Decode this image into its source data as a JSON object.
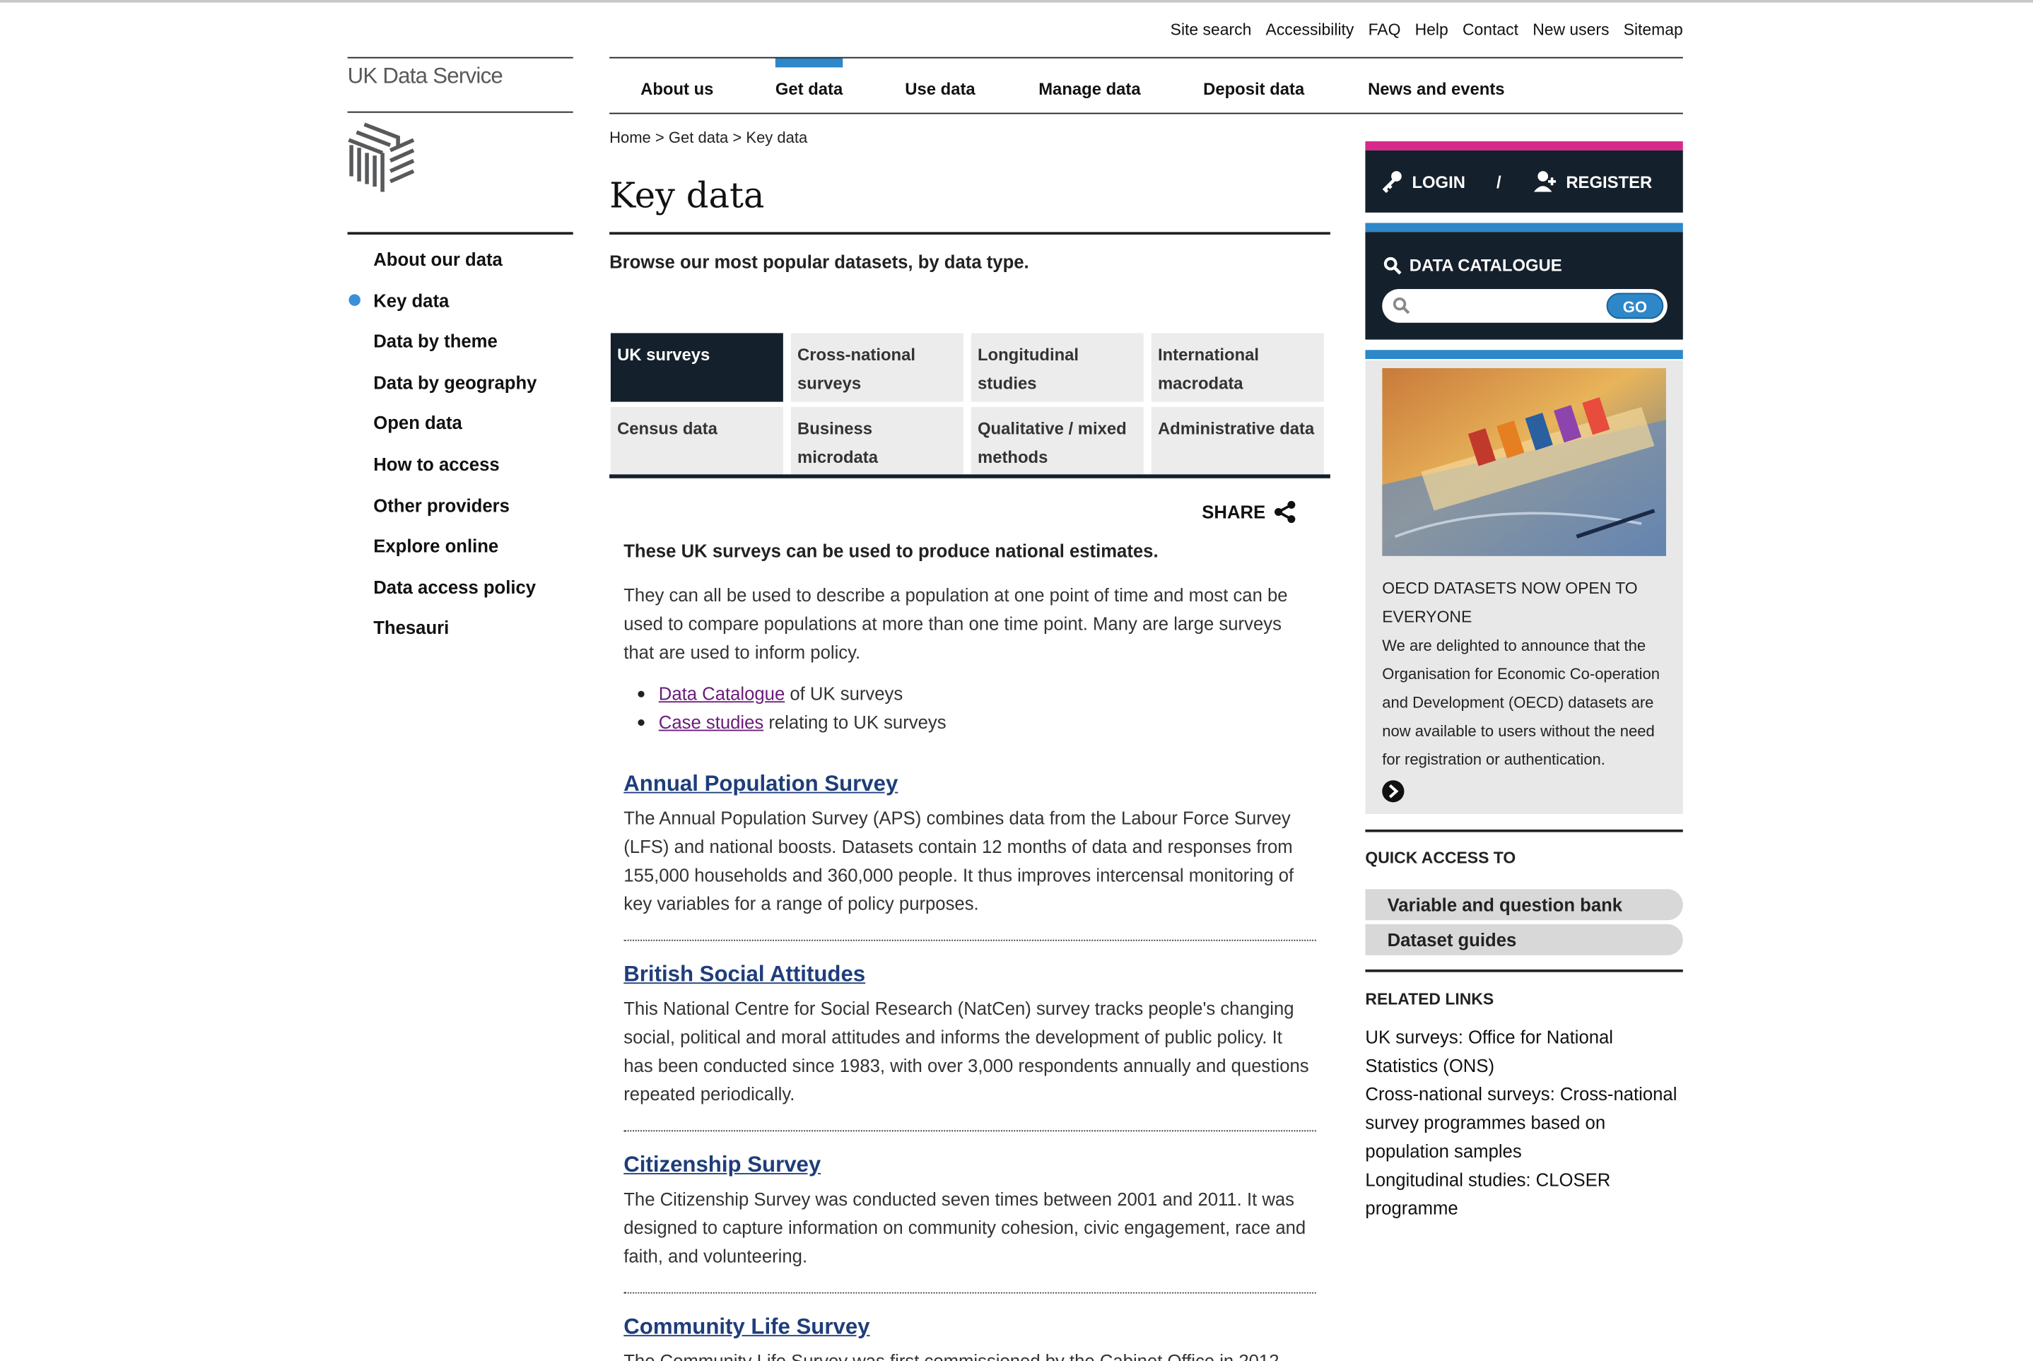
{
  "utility_links": [
    "Site search",
    "Accessibility",
    "FAQ",
    "Help",
    "Contact",
    "New users",
    "Sitemap"
  ],
  "logo": {
    "text": "UK Data Service"
  },
  "main_nav": [
    "About us",
    "Get data",
    "Use data",
    "Manage data",
    "Deposit data",
    "News and events"
  ],
  "main_nav_active": "Get data",
  "side_nav": [
    "About our data",
    "Key data",
    "Data by theme",
    "Data by geography",
    "Open data",
    "How to access",
    "Other providers",
    "Explore online",
    "Data access policy",
    "Thesauri"
  ],
  "side_nav_active": "Key data",
  "breadcrumb": "Home > Get data > Key data",
  "page": {
    "title": "Key data",
    "intro": "Browse our most popular datasets, by data type.",
    "share_label": "SHARE"
  },
  "tabs": {
    "row1": [
      "UK surveys",
      "Cross-national surveys",
      "Longitudinal studies",
      "International macrodata"
    ],
    "row2": [
      "Census data",
      "Business microdata",
      "Qualitative / mixed methods",
      "Administrative data"
    ],
    "active": "UK surveys"
  },
  "content": {
    "lead": "These UK surveys can be used to produce national estimates.",
    "paragraph": "They can all be used to describe a population at one point of time and most can be used to compare populations at more than one time point. Many are large surveys that are used to inform policy.",
    "links": [
      {
        "link": "Data Catalogue",
        "rest": " of UK surveys"
      },
      {
        "link": "Case studies",
        "rest": " relating to UK surveys"
      }
    ],
    "surveys": [
      {
        "title": "Annual Population Survey",
        "desc": "The Annual Population Survey (APS) combines data from the Labour Force Survey (LFS) and national boosts. Datasets contain 12 months of data and responses from 155,000 households and 360,000 people. It thus improves intercensal monitoring of key variables for a range of policy purposes."
      },
      {
        "title": "British Social Attitudes",
        "desc": "This National Centre for Social Research (NatCen) survey tracks people's changing social, political and moral attitudes and informs the development of public policy. It has been conducted since 1983, with over 3,000 respondents annually and questions repeated periodically."
      },
      {
        "title": "Citizenship Survey",
        "desc": "The Citizenship Survey was conducted seven times between 2001 and 2011. It was designed to capture information on community cohesion, civic engagement, race and faith, and volunteering."
      },
      {
        "title": "Community Life Survey",
        "desc": "The Community Life Survey was first commissioned by the Cabinet Office in 2012"
      }
    ]
  },
  "sidebar": {
    "login": "LOGIN",
    "separator": "/",
    "register": "REGISTER",
    "catalogue_title": "DATA CATALOGUE",
    "search_placeholder": "",
    "go_label": "GO",
    "news_title": "OECD DATASETS NOW OPEN TO EVERYONE",
    "news_body": "We are delighted to announce that the Organisation for Economic Co-operation and Development (OECD) datasets are now available to users without the need for registration or authentication.",
    "quick_access_title": "QUICK ACCESS TO",
    "quick_access": [
      "Variable and question bank",
      "Dataset guides"
    ],
    "related_title": "RELATED LINKS",
    "related": [
      "UK surveys: Office for National Statistics (ONS)",
      "Cross-national surveys: Cross-national survey programmes based on population samples",
      "Longitudinal studies: CLOSER programme"
    ]
  },
  "colors": {
    "accent_blue": "#2e87c8",
    "dark_navy": "#14202c",
    "pink": "#d62b8a",
    "link_title": "#1e3d7a",
    "visited_link": "#6a1b7a"
  }
}
